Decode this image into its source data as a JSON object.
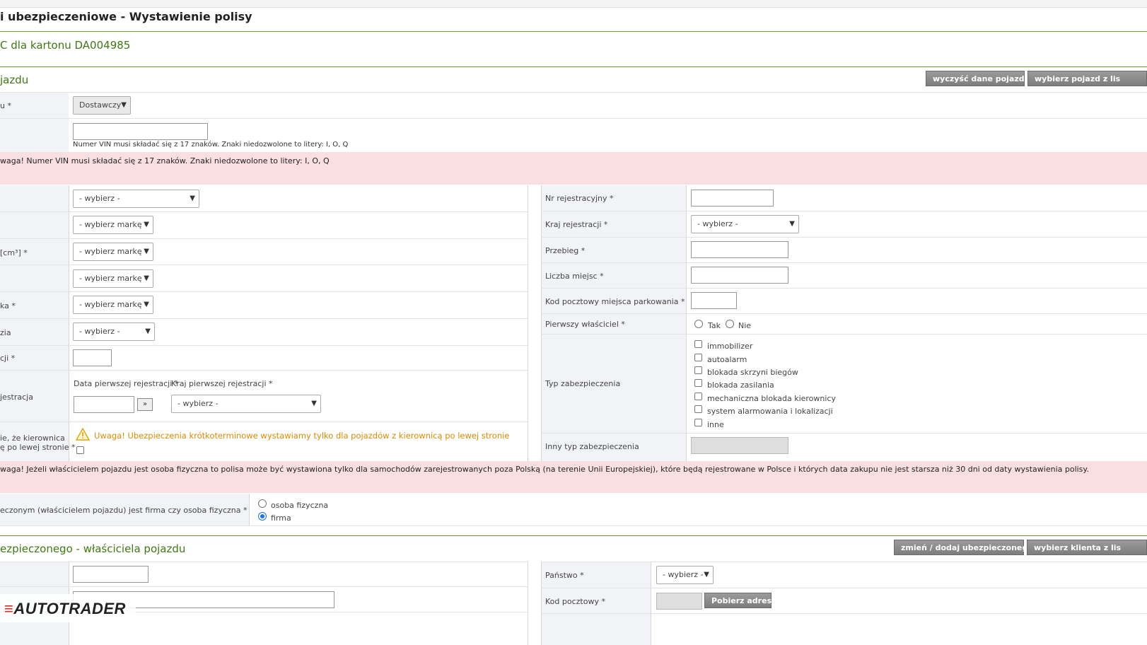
{
  "header": {
    "title": "i ubezpieczeniowe - Wystawienie polisy",
    "subtitle": "C dla kartonu DA004985"
  },
  "vehicle": {
    "section_title": "jazdu",
    "clear_button": "wyczyść dane pojazdu",
    "choose_button": "wybierz pojazd z lis",
    "type_label": "u *",
    "type_value": "Dostawczy",
    "vin_note": "Numer VIN musi składać się z 17 znaków. Znaki niedozwolone to litery: I, O, Q",
    "vin_warning": "waga! Numer VIN musi składać się z 17 znaków. Znaki niedozwolone to litery: I, O, Q",
    "left_fields": [
      {
        "label": "",
        "value": "- wybierz -"
      },
      {
        "label": "",
        "value": "- wybierz markę -"
      },
      {
        "label": "[cm³] *",
        "value": "- wybierz markę -"
      },
      {
        "label": "",
        "value": "- wybierz markę -"
      },
      {
        "label": "ka *",
        "value": "- wybierz markę -"
      },
      {
        "label": "zia",
        "value": "- wybierz -"
      },
      {
        "label": "cji *",
        "value": ""
      }
    ],
    "first_reg_row_label": "jestracja",
    "first_reg_date_label": "Data pierwszej rejestracji *",
    "first_reg_country_label": "Kraj pierwszej rejestracji *",
    "first_reg_btn": "»",
    "first_reg_country_value": "- wybierz -",
    "steering_label_1": "ie, że kierownica",
    "steering_label_2": "ę po lewej stronie *",
    "steering_warning": "Uwaga! Ubezpieczenia krótkoterminowe wystawiamy tylko dla pojazdów z kierownicą po lewej stronie",
    "right_fields": {
      "reg_no": "Nr rejestracyjny *",
      "reg_country": "Kraj rejestracji *",
      "reg_country_value": "- wybierz -",
      "mileage": "Przebieg *",
      "seats": "Liczba miejsc *",
      "postcode": "Kod pocztowy miejsca parkowania *",
      "first_owner": "Pierwszy właściciel *",
      "first_owner_yes": "Tak",
      "first_owner_no": "Nie",
      "security_type": "Typ zabezpieczenia",
      "other_security": "Inny typ zabezpieczenia"
    },
    "security_options": [
      "immobilizer",
      "autoalarm",
      "blokada skrzyni biegów",
      "blokada zasilania",
      "mechaniczna blokada kierownicy",
      "system alarmowania i lokalizacji",
      "inne"
    ],
    "owner_warning": "waga! Jeżeli właścicielem pojazdu jest osoba fizyczna to polisa może być wystawiona tylko dla samochodów zarejestrowanych poza Polską (na terenie Unii Europejskiej), które będą rejestrowane w Polsce i których data zakupu nie jest starsza niż 30 dni od daty wystawienia polisy.",
    "owner_type_label": "eczonym (właścicielem pojazdu) jest firma czy osoba fizyczna *",
    "owner_type_options": [
      "osoba fizyczna",
      "firma"
    ],
    "owner_type_selected": "firma"
  },
  "insured": {
    "section_title": "ezpieczonego - właściciela pojazdu",
    "change_button": "zmień / dodaj ubezpieczonego",
    "choose_button": "wybierz klienta z lis",
    "country_label": "Państwo *",
    "country_value": "- wybierz -",
    "postcode_label": "Kod pocztowy *",
    "fetch_address_button": "Pobierz adres"
  },
  "brand": {
    "logo": "AUTOTRADER"
  },
  "colors": {
    "accent_green": "#3d7a11",
    "warning_bg": "#f9dfe1",
    "warning_orange": "#e08a00",
    "button_grey": "#8a8a8a"
  }
}
